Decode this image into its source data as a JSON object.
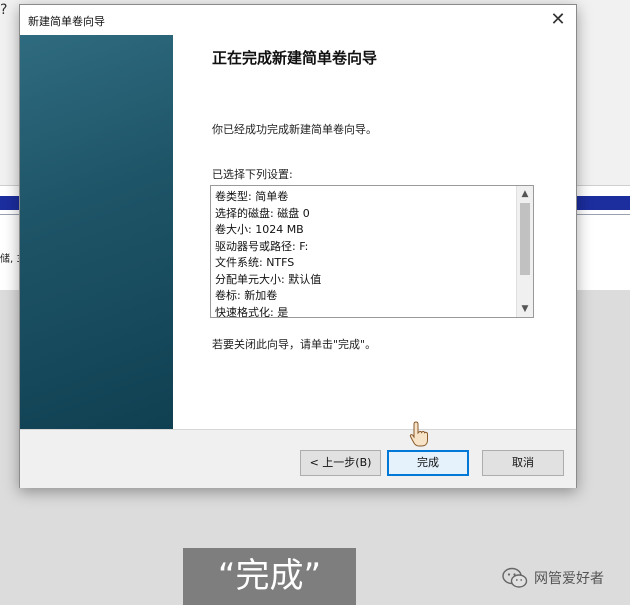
{
  "dialog": {
    "title": "新建简单卷向导",
    "heading": "正在完成新建简单卷向导",
    "description": "你已经成功完成新建简单卷向导。",
    "settings_label": "已选择下列设置:",
    "settings": [
      "卷类型: 简单卷",
      "选择的磁盘: 磁盘 0",
      "卷大小: 1024 MB",
      "驱动器号或路径: F:",
      "文件系统: NTFS",
      "分配单元大小: 默认值",
      "卷标: 新加卷",
      "快速格式化: 是"
    ],
    "closing_note": "若要关闭此向导，请单击\"完成\"。",
    "buttons": {
      "back": "< 上一步(B)",
      "finish": "完成",
      "cancel": "取消"
    }
  },
  "background": {
    "partial_text": "储, 3",
    "qmark": "?"
  },
  "caption": "“完成”",
  "watermark": {
    "icon": "wechat-icon",
    "text": "网管爱好者"
  },
  "colors": {
    "sidebar_accent": "#1f5568",
    "focus_blue": "#0078d7",
    "bg_stripe": "#1c2d9e"
  }
}
